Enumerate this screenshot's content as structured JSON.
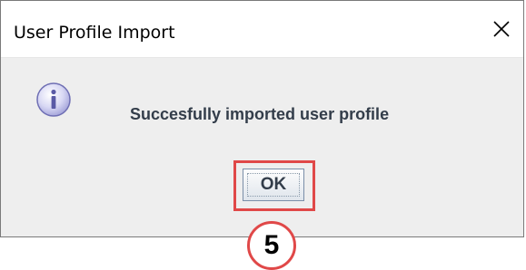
{
  "dialog": {
    "title": "User Profile Import",
    "message": "Succesfully imported user profile",
    "ok_label": "OK"
  },
  "annotation": {
    "step_number": "5",
    "highlight_color": "#e04848"
  },
  "icons": {
    "close": "close-icon",
    "info": "info-icon"
  }
}
